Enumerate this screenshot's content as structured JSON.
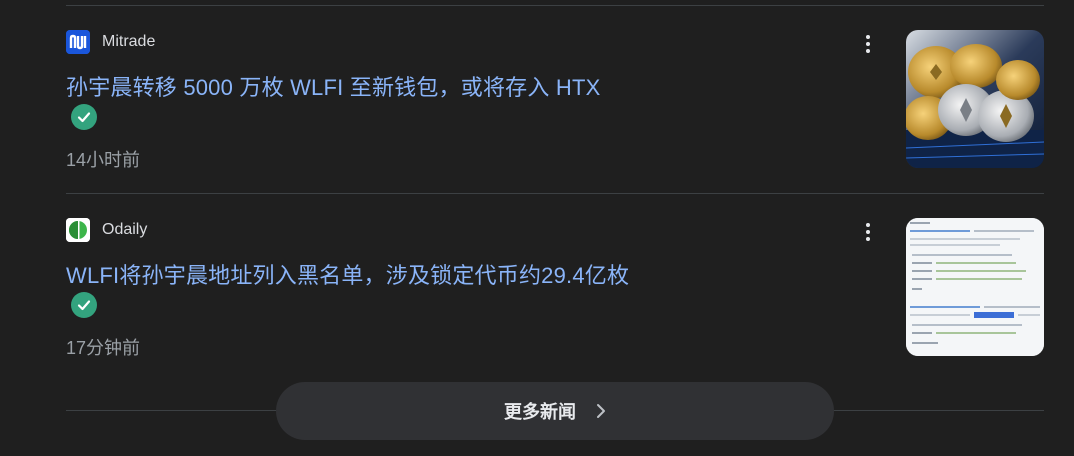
{
  "news": [
    {
      "source": "Mitrade",
      "favicon_icon": "mitrade-logo-icon",
      "favicon_color": "#1a56db",
      "headline": "孙宇晨转移 5000 万枚 WLFI 至新钱包，或将存入 HTX",
      "time": "14小时前",
      "thumbnail": "crypto-coins-image"
    },
    {
      "source": "Odaily",
      "favicon_icon": "odaily-logo-icon",
      "favicon_color": "#3cb54a",
      "headline": "WLFI将孙宇晨地址列入黑名单，涉及锁定代币约29.4亿枚",
      "time": "17分钟前",
      "thumbnail": "etherscan-screenshot-image"
    }
  ],
  "more_news": {
    "label": "更多新闻",
    "icon": "chevron-right-icon"
  },
  "colors": {
    "background": "#1f1f1f",
    "headline": "#8ab4f8",
    "verified": "#33a37e",
    "divider": "#3c4043",
    "button": "#303134"
  }
}
